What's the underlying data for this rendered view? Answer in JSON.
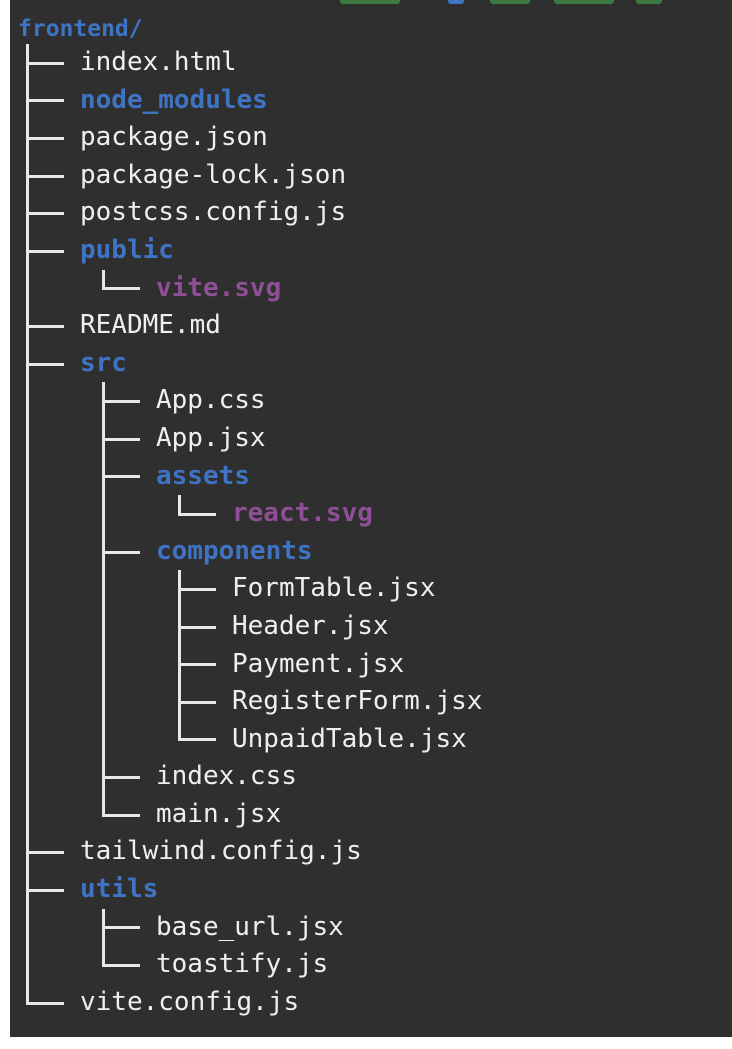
{
  "theme": {
    "background": "#2f2f2f",
    "file_color": "#efefef",
    "directory_color": "#3f74c4",
    "svg_file_color": "#8e4f96",
    "branch_color": "#e8e8e8"
  },
  "tree": {
    "root": "frontend/",
    "items": [
      {
        "label": "index.html",
        "kind": "file",
        "depth": 1,
        "last": false
      },
      {
        "label": "node_modules",
        "kind": "directory",
        "depth": 1,
        "last": false
      },
      {
        "label": "package.json",
        "kind": "file",
        "depth": 1,
        "last": false
      },
      {
        "label": "package-lock.json",
        "kind": "file",
        "depth": 1,
        "last": false
      },
      {
        "label": "postcss.config.js",
        "kind": "file",
        "depth": 1,
        "last": false
      },
      {
        "label": "public",
        "kind": "directory",
        "depth": 1,
        "last": false
      },
      {
        "label": "vite.svg",
        "kind": "svg",
        "depth": 2,
        "last": true
      },
      {
        "label": "README.md",
        "kind": "file",
        "depth": 1,
        "last": false
      },
      {
        "label": "src",
        "kind": "directory",
        "depth": 1,
        "last": false
      },
      {
        "label": "App.css",
        "kind": "file",
        "depth": 2,
        "last": false
      },
      {
        "label": "App.jsx",
        "kind": "file",
        "depth": 2,
        "last": false
      },
      {
        "label": "assets",
        "kind": "directory",
        "depth": 2,
        "last": false
      },
      {
        "label": "react.svg",
        "kind": "svg",
        "depth": 3,
        "last": true
      },
      {
        "label": "components",
        "kind": "directory",
        "depth": 2,
        "last": false
      },
      {
        "label": "FormTable.jsx",
        "kind": "file",
        "depth": 3,
        "last": false
      },
      {
        "label": "Header.jsx",
        "kind": "file",
        "depth": 3,
        "last": false
      },
      {
        "label": "Payment.jsx",
        "kind": "file",
        "depth": 3,
        "last": false
      },
      {
        "label": "RegisterForm.jsx",
        "kind": "file",
        "depth": 3,
        "last": false
      },
      {
        "label": "UnpaidTable.jsx",
        "kind": "file",
        "depth": 3,
        "last": true
      },
      {
        "label": "index.css",
        "kind": "file",
        "depth": 2,
        "last": false
      },
      {
        "label": "main.jsx",
        "kind": "file",
        "depth": 2,
        "last": true
      },
      {
        "label": "tailwind.config.js",
        "kind": "file",
        "depth": 1,
        "last": false
      },
      {
        "label": "utils",
        "kind": "directory",
        "depth": 1,
        "last": false
      },
      {
        "label": "base_url.jsx",
        "kind": "file",
        "depth": 2,
        "last": false
      },
      {
        "label": "toastify.js",
        "kind": "file",
        "depth": 2,
        "last": true
      },
      {
        "label": "vite.config.js",
        "kind": "file",
        "depth": 1,
        "last": true
      }
    ]
  }
}
